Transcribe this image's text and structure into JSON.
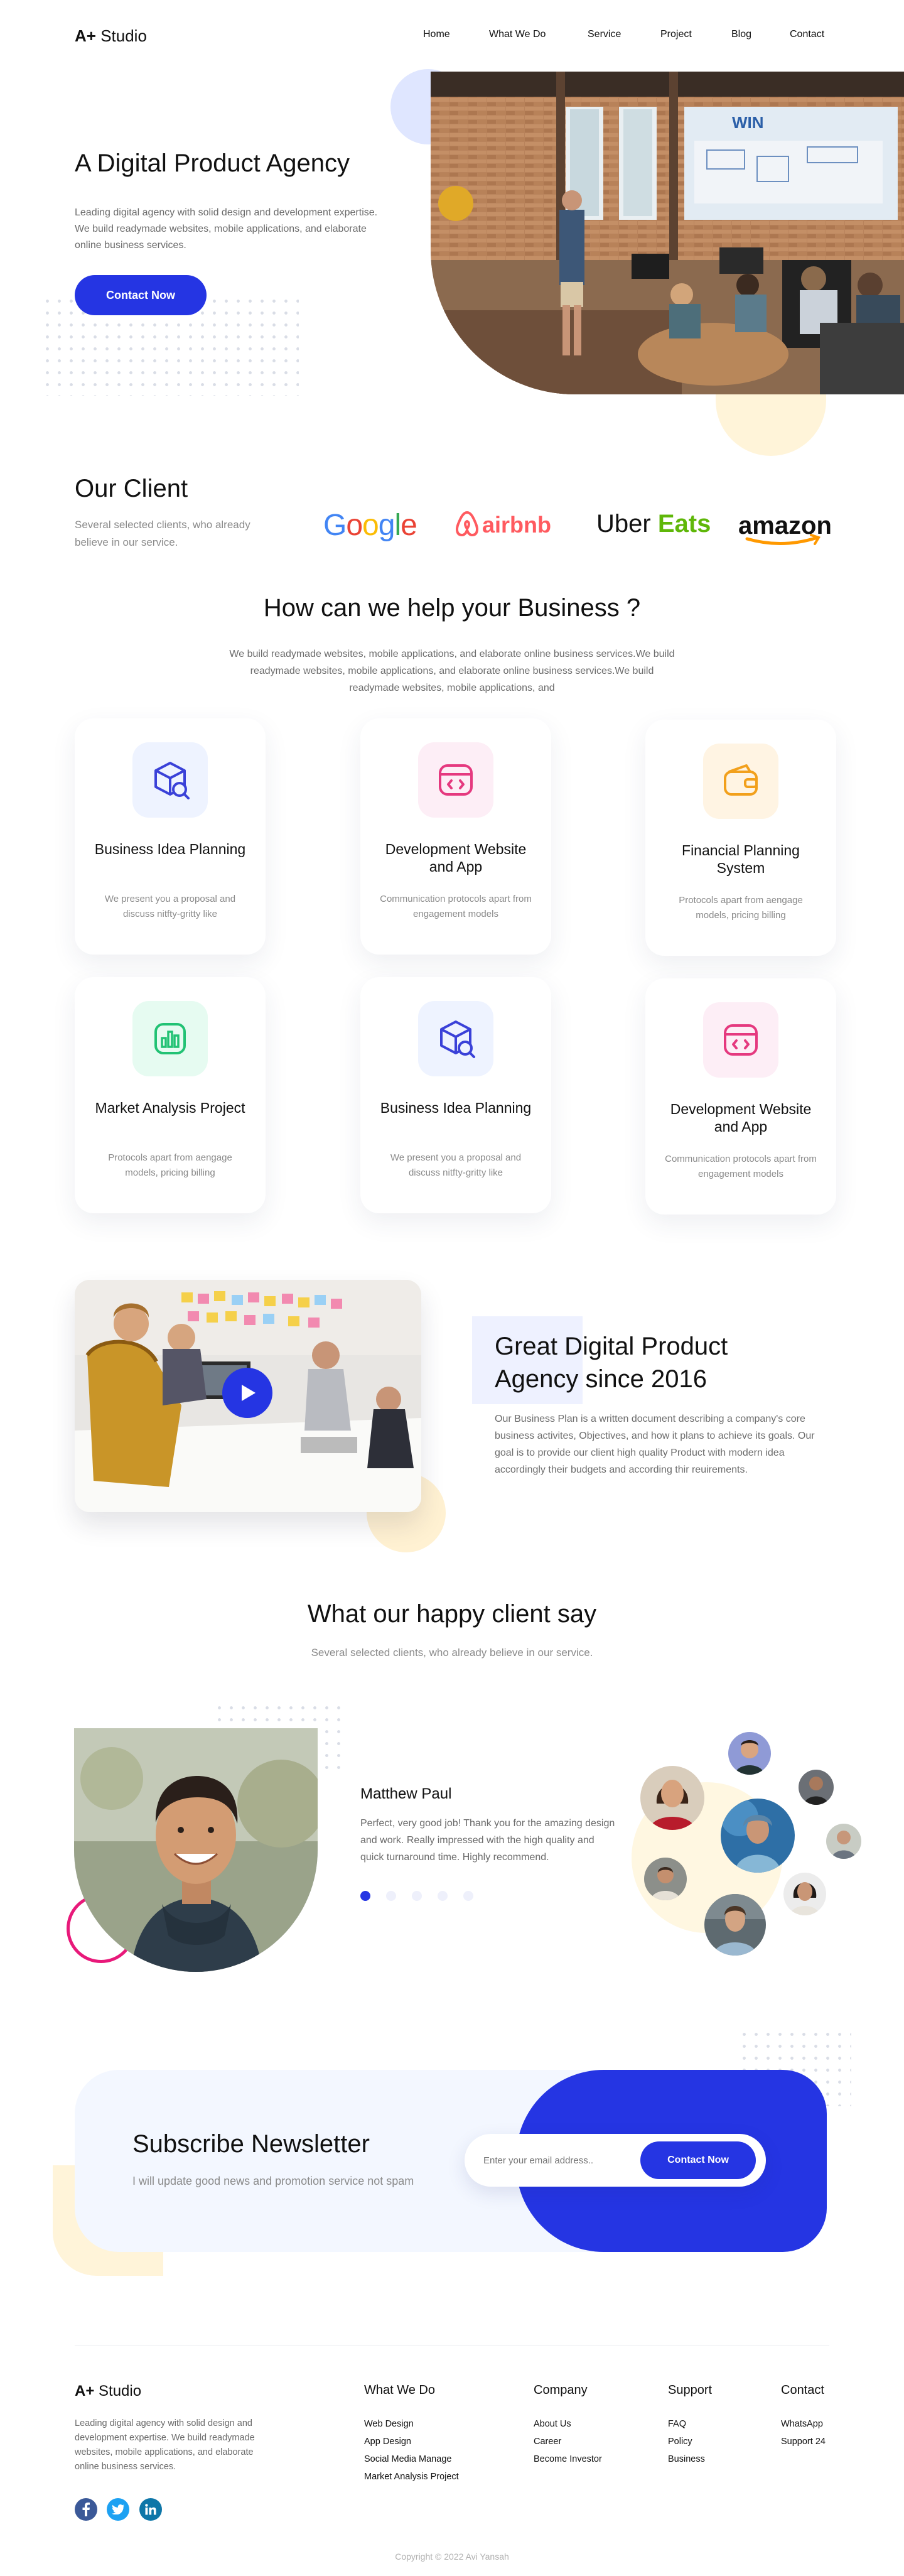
{
  "brand": {
    "logo_prefix": "A+",
    "logo_name": " Studio"
  },
  "nav": {
    "items": [
      {
        "label": "Home"
      },
      {
        "label": "What We Do"
      },
      {
        "label": "Service"
      },
      {
        "label": "Project"
      },
      {
        "label": "Blog"
      },
      {
        "label": "Contact"
      }
    ]
  },
  "hero": {
    "title": "A Digital Product Agency",
    "text": "Leading digital agency with solid design and development expertise. We build readymade websites, mobile applications, and elaborate online business services.",
    "button": "Contact Now",
    "image_alt": "Presenter speaking to a team in a brick office"
  },
  "clients": {
    "title": "Our Client",
    "text": "Several selected clients, who already believe in our service.",
    "logos": [
      "Google",
      "airbnb",
      "Uber Eats",
      "amazon"
    ]
  },
  "services": {
    "title": "How can we help your Business ?",
    "subtitle": "We build readymade websites, mobile applications, and elaborate online business services.We build readymade websites, mobile applications, and elaborate online business services.We build readymade websites, mobile applications, and",
    "cards": [
      {
        "title": "Business Idea Planning",
        "text": "We present you a proposal and discuss nitfty-gritty like",
        "icon": "cube-search-icon",
        "bg": "#eef3ff",
        "color": "#3a41d8"
      },
      {
        "title": "Development Website and App",
        "text": "Communication protocols apart from engagement models",
        "icon": "code-window-icon",
        "bg": "#fdeef6",
        "color": "#e5397f"
      },
      {
        "title": "Financial Planning System",
        "text": "Protocols apart from aengage models, pricing billing",
        "icon": "wallet-icon",
        "bg": "#fff4e3",
        "color": "#f2a01c"
      },
      {
        "title": "Market Analysis Project",
        "text": "Protocols apart from aengage models, pricing billing",
        "icon": "bar-chart-icon",
        "bg": "#e6fbf1",
        "color": "#22c274"
      },
      {
        "title": "Business Idea Planning",
        "text": "We present you a proposal and discuss nitfty-gritty like",
        "icon": "cube-search-icon",
        "bg": "#eef3ff",
        "color": "#3a41d8"
      },
      {
        "title": "Development Website and App",
        "text": "Communication protocols apart from engagement models",
        "icon": "code-window-icon",
        "bg": "#fdeef6",
        "color": "#e5397f"
      }
    ]
  },
  "about": {
    "title": "Great Digital Product Agency since 2016",
    "text": "Our Business Plan is a written document describing a company's core business activites, Objectives, and how it plans to achieve its goals. Our goal is to provide our client high quality Product with modern idea accordingly their budgets and according thir reuirements."
  },
  "testimonials": {
    "title": "What our happy client say",
    "subtitle": "Several selected clients, who already believe in our service.",
    "name": "Matthew Paul",
    "quote": "Perfect, very good job! Thank you for the amazing design and work. Really impressed with the high quality and quick turnaround time. Highly recommend.",
    "active_slide": 1,
    "slide_count": 5
  },
  "newsletter": {
    "title": "Subscribe Newsletter",
    "subtitle": "I will update good news and promotion service not spam",
    "placeholder": "Enter your email address..",
    "button": "Contact Now"
  },
  "footer": {
    "text": "Leading digital agency with solid design and development expertise. We build readymade websites, mobile applications, and elaborate online business services.",
    "columns": [
      {
        "title": "What We Do",
        "links": [
          "Web Design",
          "App Design",
          "Social Media Manage",
          "Market Analysis Project"
        ]
      },
      {
        "title": "Company",
        "links": [
          "About Us",
          "Career",
          "Become Investor"
        ]
      },
      {
        "title": "Support",
        "links": [
          "FAQ",
          "Policy",
          "Business"
        ]
      },
      {
        "title": "Contact",
        "links": [
          "WhatsApp",
          "Support 24"
        ]
      }
    ],
    "social": [
      "facebook-icon",
      "twitter-icon",
      "linkedin-icon"
    ],
    "copyright": "Copyright © 2022 Avi Yansah"
  },
  "colors": {
    "accent": "#2535e3",
    "pink": "#e8197a",
    "yellow_soft": "#fff4d9",
    "blue_soft": "#dfe6ff"
  }
}
